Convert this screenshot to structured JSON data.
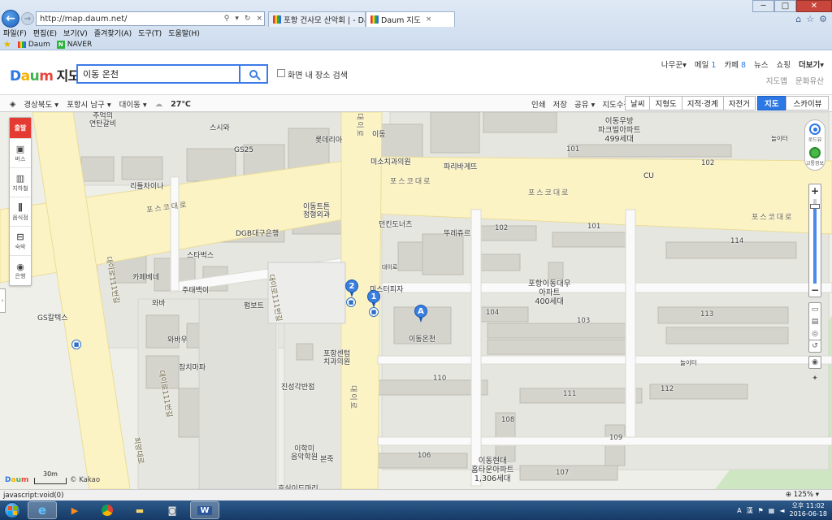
{
  "browser": {
    "url": "http://map.daum.net/",
    "tabs": [
      {
        "title": "포항 건사모 산악회 | - Daum ..."
      },
      {
        "title": "Daum 지도"
      }
    ],
    "menu": [
      "파일(F)",
      "편집(E)",
      "보기(V)",
      "즐겨찾기(A)",
      "도구(T)",
      "도움말(H)"
    ],
    "favorites": [
      "Daum",
      "NAVER"
    ]
  },
  "header": {
    "logo": "Daum",
    "service": "지도",
    "search_value": "이동 온천",
    "checkbox_label": "화면 내 장소 검색",
    "nav": [
      {
        "label": "나무꾼",
        "suffix": "▾"
      },
      {
        "label": "메일",
        "count": "1"
      },
      {
        "label": "카페",
        "count": "8"
      },
      {
        "label": "뉴스"
      },
      {
        "label": "쇼핑"
      },
      {
        "label": "더보기",
        "suffix": "▾"
      }
    ],
    "nav2": [
      "지도앱",
      "문화유산"
    ]
  },
  "toolbar": {
    "region": [
      "경상북도",
      "포항시 남구",
      "대이동"
    ],
    "temperature": "27",
    "temp_unit": "℃",
    "tools": [
      "인쇄",
      "저장",
      "공유",
      "지도수정"
    ],
    "modes": [
      "날씨",
      "지형도",
      "지적·경계",
      "자전거"
    ],
    "types": [
      "지도",
      "스카이뷰"
    ],
    "active_type": "지도"
  },
  "sidebar": {
    "departure": "출발",
    "items": [
      {
        "label": "버스",
        "icon": "bus-icon"
      },
      {
        "label": "지하철",
        "icon": "subway-icon"
      },
      {
        "label": "음식점",
        "icon": "restaurant-icon"
      },
      {
        "label": "숙박",
        "icon": "bed-icon"
      },
      {
        "label": "은행",
        "icon": "bank-icon"
      }
    ]
  },
  "right_controls": {
    "roadview": "로드뷰",
    "traffic": "교통정보"
  },
  "map": {
    "roads": [
      "포스코대로",
      "포스코대로",
      "포스코대로",
      "포스코대로",
      "대이로",
      "대이로",
      "대이로",
      "대이로111번길",
      "대이로111번길",
      "대이로111번길",
      "희망대로"
    ],
    "apartments": [
      {
        "name": "이동우방\n파크빌아파트",
        "units": "499세대"
      },
      {
        "name": "포항이동대우\n아파트",
        "units": "400세대"
      },
      {
        "name": "이동현대\n홈타운아파트",
        "units": "1,306세대"
      }
    ],
    "buildings": [
      "101",
      "102",
      "102",
      "101",
      "114",
      "104",
      "103",
      "113",
      "110",
      "111",
      "112",
      "108",
      "109",
      "106",
      "107"
    ],
    "places": [
      "추억의\n연탄갈비",
      "스시와",
      "GS25",
      "롯데리아",
      "이동",
      "미소치과의원",
      "파리바게뜨",
      "리틀차이나",
      "CU",
      "놀이터",
      "이동트튼\n정형외과",
      "던킨도너츠",
      "뚜레쥬르",
      "DGB대구은행",
      "스타벅스",
      "카페베네",
      "주태백이",
      "와바",
      "미스터피자",
      "대이로",
      "펌보트",
      "GS칼텍스",
      "와바우",
      "참치마파",
      "포항센텀\n치과의원",
      "진성각반점",
      "이학미\n음악학원",
      "본죽",
      "놀이터",
      "효심이드마리",
      "이동온천"
    ],
    "markers": [
      "2",
      "1",
      "A"
    ]
  },
  "map_footer": {
    "logo": "Daum",
    "scale": "30m",
    "copyright": "© Kakao"
  },
  "status": {
    "text": "javascript:void(0)",
    "zoom": "125%"
  },
  "taskbar": {
    "time": "오후 11:02",
    "date": "2016-06-18",
    "ime": "A",
    "ime2": "漢"
  }
}
